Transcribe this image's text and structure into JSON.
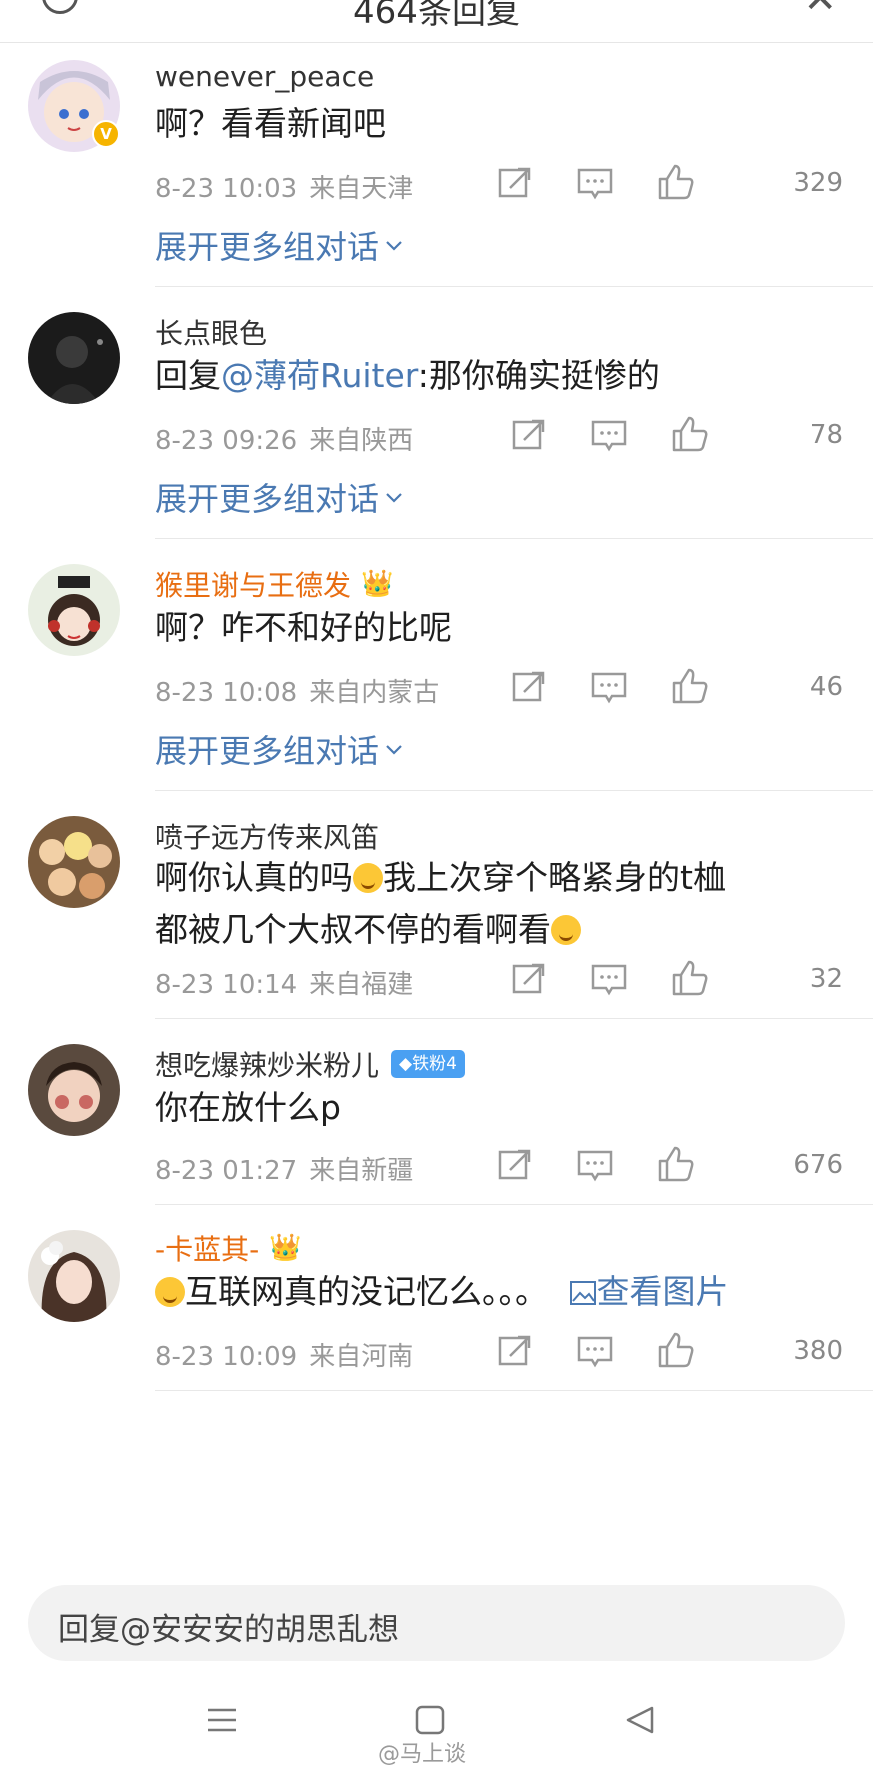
{
  "header": {
    "title": "464条回复",
    "back_icon": "back-circle-icon",
    "close_icon": "close-icon"
  },
  "colors": {
    "link": "#4a79b2",
    "vip_name": "#e86e12",
    "meta": "#999999",
    "badge": "#4aa0f2"
  },
  "comments": [
    {
      "name": "wenever_peace",
      "verified": true,
      "text": "啊？看看新闻吧",
      "date": "8-23 10:03",
      "location": "来自天津",
      "likes": "329",
      "expand": "展开更多组对话"
    },
    {
      "name": "长点眼色",
      "reply_prefix": "回复",
      "mention": "@薄荷Ruiter",
      "text": ":那你确实挺惨的",
      "date": "8-23 09:26",
      "location": "来自陕西",
      "likes": "78",
      "expand": "展开更多组对话"
    },
    {
      "name": "猴里谢与王德发",
      "vip": true,
      "text": "啊？咋不和好的比呢",
      "date": "8-23 10:08",
      "location": "来自内蒙古",
      "likes": "46",
      "expand": "展开更多组对话"
    },
    {
      "name": "喷子远方传来风笛",
      "text_part1": "啊你认真的吗",
      "text_part2": "我上次穿个略紧身的t桖都被几个大叔不停的看啊看",
      "date": "8-23 10:14",
      "location": "来自福建",
      "likes": "32"
    },
    {
      "name": "想吃爆辣炒米粉儿",
      "badge": "铁粉4",
      "text": "你在放什么p",
      "date": "8-23 01:27",
      "location": "来自新疆",
      "likes": "676"
    },
    {
      "name": "-卡蓝其-",
      "vip": true,
      "text": "互联网真的没记忆么。。。",
      "view_picture": "查看图片",
      "date": "8-23 10:09",
      "location": "来自河南",
      "likes": "380"
    }
  ],
  "reply_box": {
    "placeholder": "回复@安安安的胡思乱想"
  },
  "watermark": "@马上谈"
}
